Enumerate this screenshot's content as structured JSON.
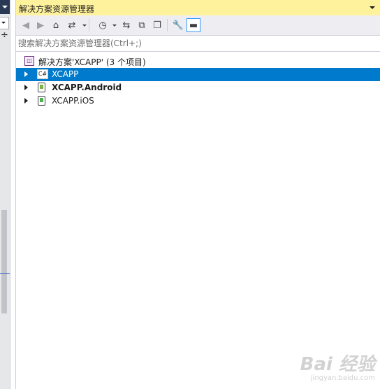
{
  "panel": {
    "title": "解决方案资源管理器"
  },
  "toolbar": {
    "buttons": [
      {
        "name": "back-button",
        "glyph": "◀",
        "disabled": true
      },
      {
        "name": "forward-button",
        "glyph": "▶",
        "disabled": true
      },
      {
        "name": "home-button",
        "glyph": "⌂"
      },
      {
        "name": "switch-views-button",
        "glyph": "⇄"
      },
      {
        "name": "pending-changes-filter-button",
        "glyph": "◷"
      },
      {
        "name": "sync-with-active-document-button",
        "glyph": "⇆"
      },
      {
        "name": "collapse-all-button",
        "glyph": "⧉"
      },
      {
        "name": "show-all-files-button",
        "glyph": "❐"
      },
      {
        "name": "properties-button",
        "glyph": "🔧"
      },
      {
        "name": "preview-selected-items-button",
        "glyph": "▬"
      }
    ]
  },
  "search": {
    "placeholder": "搜索解决方案资源管理器(Ctrl+;)"
  },
  "tree": {
    "solution_label": "解决方案'XCAPP' (3 个项目)",
    "projects": [
      {
        "label": "XCAPP",
        "icon": "csharp-project-icon",
        "selected": true,
        "bold": false
      },
      {
        "label": "XCAPP.Android",
        "icon": "android-project-icon",
        "selected": false,
        "bold": true
      },
      {
        "label": "XCAPP.iOS",
        "icon": "ios-project-icon",
        "selected": false,
        "bold": false
      }
    ]
  },
  "watermark": {
    "logo": "Bai 经验",
    "url": "jingyan.baidu.com"
  },
  "colors": {
    "title_bar": "#fff29d",
    "selection": "#007acc",
    "toolbar": "#eeeef2"
  }
}
